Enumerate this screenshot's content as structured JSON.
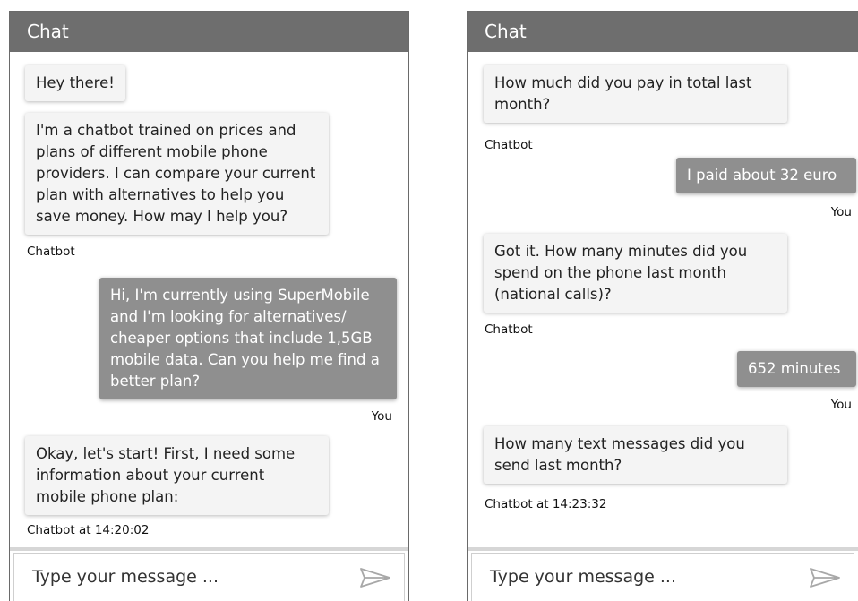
{
  "left_panel": {
    "title": "Chat",
    "messages": [
      {
        "from": "bot",
        "text": "Hey there!"
      },
      {
        "from": "bot",
        "text": "I'm a chatbot trained on prices and plans of different mobile phone providers. I can compare your current plan with alternatives to help you save money. How may I help you?",
        "sender": "Chatbot"
      },
      {
        "from": "user",
        "text": "Hi, I'm currently using SuperMobile and I'm looking for alternatives/ cheaper options that include 1,5GB mobile data. Can you help me find a better plan?",
        "sender": "You"
      },
      {
        "from": "bot",
        "text": "Okay, let's start! First, I need some information about your current mobile phone plan:",
        "sender": "Chatbot at 14:20:02"
      }
    ],
    "input": {
      "placeholder": "Type your message ...",
      "send_icon": "send-icon"
    }
  },
  "right_panel": {
    "title": "Chat",
    "messages": [
      {
        "from": "bot",
        "text": "How much did you pay in total last month?",
        "sender": "Chatbot"
      },
      {
        "from": "user",
        "text": "I paid about 32 euro",
        "sender": "You"
      },
      {
        "from": "bot",
        "text": "Got it. How many minutes did you spend on the phone last month (national calls)?",
        "sender": "Chatbot"
      },
      {
        "from": "user",
        "text": "652 minutes",
        "sender": "You"
      },
      {
        "from": "bot",
        "text": "How many text messages did you send last month?",
        "sender": "Chatbot at 14:23:32"
      }
    ],
    "input": {
      "placeholder": "Type your message ...",
      "send_icon": "send-icon"
    }
  },
  "colors": {
    "header_bg": "#6e6e6e",
    "bot_bubble": "#f4f4f4",
    "user_bubble": "#8f8f8f"
  }
}
